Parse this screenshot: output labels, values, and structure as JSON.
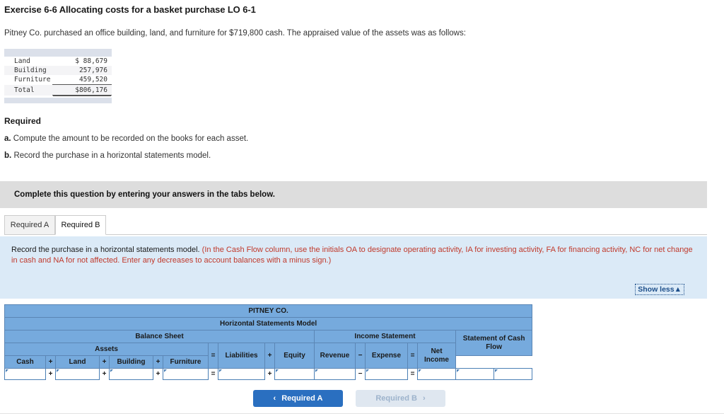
{
  "exercise": {
    "title": "Exercise 6-6 Allocating costs for a basket purchase LO 6-1",
    "prompt": "Pitney Co. purchased an office building, land, and furniture for $719,800 cash. The appraised value of the assets was as follows:"
  },
  "appraisal_table": {
    "rows": [
      {
        "label": "Land",
        "value": "$ 88,679"
      },
      {
        "label": "Building",
        "value": "257,976"
      },
      {
        "label": "Furniture",
        "value": "459,520"
      }
    ],
    "total": {
      "label": "Total",
      "value": "$806,176"
    }
  },
  "required": {
    "heading": "Required",
    "items": [
      {
        "marker": "a.",
        "text": "Compute the amount to be recorded on the books for each asset."
      },
      {
        "marker": "b.",
        "text": "Record the purchase in a horizontal statements model."
      }
    ]
  },
  "complete_banner": "Complete this question by entering your answers in the tabs below.",
  "tabs": [
    {
      "label": "Required A",
      "active": false
    },
    {
      "label": "Required B",
      "active": true
    }
  ],
  "instruction_panel": {
    "main": "Record the purchase in a horizontal statements model.",
    "hint": "(In the Cash Flow column, use the initials OA to designate operating activity, IA for investing activity, FA for financing activity, NC for net change in cash and NA for not affected. Enter any decreases to account balances with a minus sign.)",
    "show_less": "Show less▲"
  },
  "statements_model": {
    "company": "PITNEY CO.",
    "subtitle": "Horizontal Statements Model",
    "groups": {
      "balance_sheet": "Balance Sheet",
      "income_statement": "Income Statement",
      "assets": "Assets",
      "cash_flow": "Statement of Cash Flow"
    },
    "columns": {
      "cash": "Cash",
      "land": "Land",
      "building": "Building",
      "furniture": "Furniture",
      "liabilities": "Liabilities",
      "equity": "Equity",
      "revenue": "Revenue",
      "expense": "Expense",
      "net_income": "Net Income"
    },
    "operators": {
      "plus": "+",
      "equals": "=",
      "minus": "−"
    },
    "input_values": {
      "cash": "",
      "land": "",
      "building": "",
      "furniture": "",
      "liabilities": "",
      "equity": "",
      "revenue": "",
      "expense": "",
      "net_income": "",
      "cash_flow_amount": "",
      "cash_flow_code": ""
    }
  },
  "navigation": {
    "prev_label": "Required A",
    "next_label": "Required B",
    "prev_chevron": "‹",
    "next_chevron": "›"
  },
  "colors": {
    "table_header_blue": "#76aadd",
    "panel_blue": "#dbeaf7",
    "hint_red": "#c0392b",
    "button_blue": "#2a6fc0",
    "banner_grey": "#dddddd"
  }
}
